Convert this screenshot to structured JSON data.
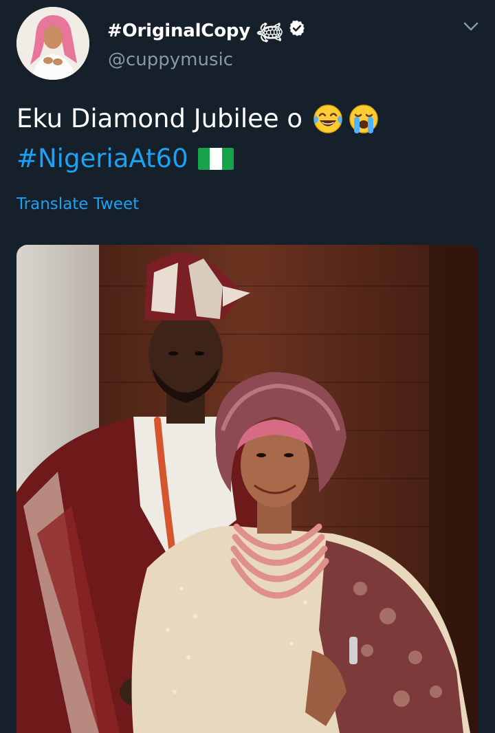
{
  "tweet": {
    "author": {
      "display_name": "#OriginalCopy 𓆉",
      "handle": "@cuppymusic",
      "verified": true,
      "avatar_icon": "profile-photo"
    },
    "text_line1": "Eku Diamond Jubilee o",
    "emojis": [
      "face-with-tears-of-joy-emoji",
      "loudly-crying-face-emoji"
    ],
    "hashtag": "#NigeriaAt60",
    "flag_icon": "nigeria-flag-emoji",
    "translate_label": "Translate Tweet",
    "media": {
      "type": "photo"
    },
    "menu_icon": "chevron-down-icon"
  },
  "colors": {
    "background": "#15202b",
    "primary_text": "#ffffff",
    "secondary_text": "#8899a6",
    "link": "#1da1f2"
  }
}
